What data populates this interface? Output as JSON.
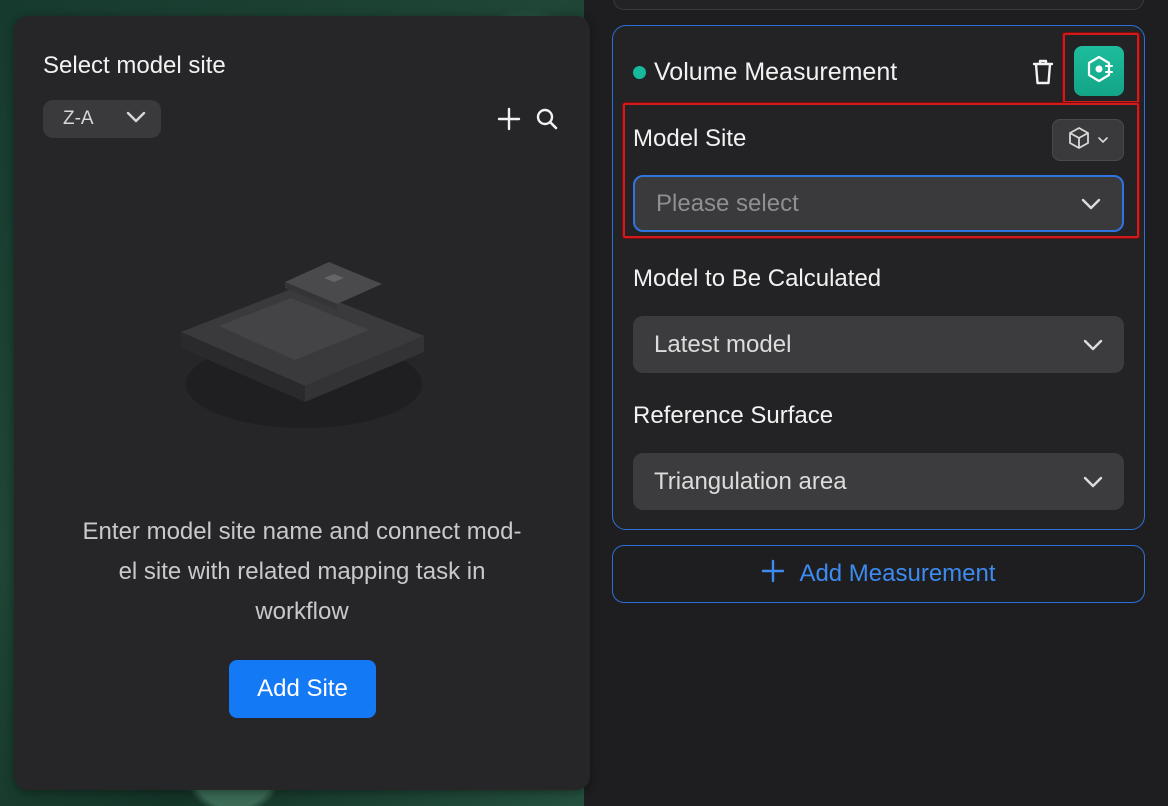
{
  "site_panel": {
    "title": "Select model site",
    "sort": {
      "selected": "Z-A"
    },
    "tools": {
      "add_icon": "plus-icon",
      "search_icon": "search-icon"
    },
    "empty": {
      "illustration": "empty-box-illustration",
      "message": "Enter model site name and connect mod-el site with related mapping task in workflow",
      "line1": "Enter model site name and connect mod-",
      "line2": "el site with related mapping task in",
      "line3": "workflow"
    },
    "add_button": "Add Site"
  },
  "measurement": {
    "title": "Volume Measurement",
    "status_color": "#17b89b",
    "delete_icon": "trash-icon",
    "action_icon": "measure-target-icon",
    "fields": {
      "model_site": {
        "label": "Model Site",
        "type_icon": "cube-icon",
        "placeholder": "Please select"
      },
      "model_calc": {
        "label": "Model to Be Calculated",
        "value": "Latest model"
      },
      "reference": {
        "label": "Reference Surface",
        "value": "Triangulation area"
      }
    }
  },
  "add_measurement": "Add Measurement",
  "colors": {
    "accent": "#1479f5",
    "teal": "#17b89b",
    "highlight": "#d11b1b"
  }
}
